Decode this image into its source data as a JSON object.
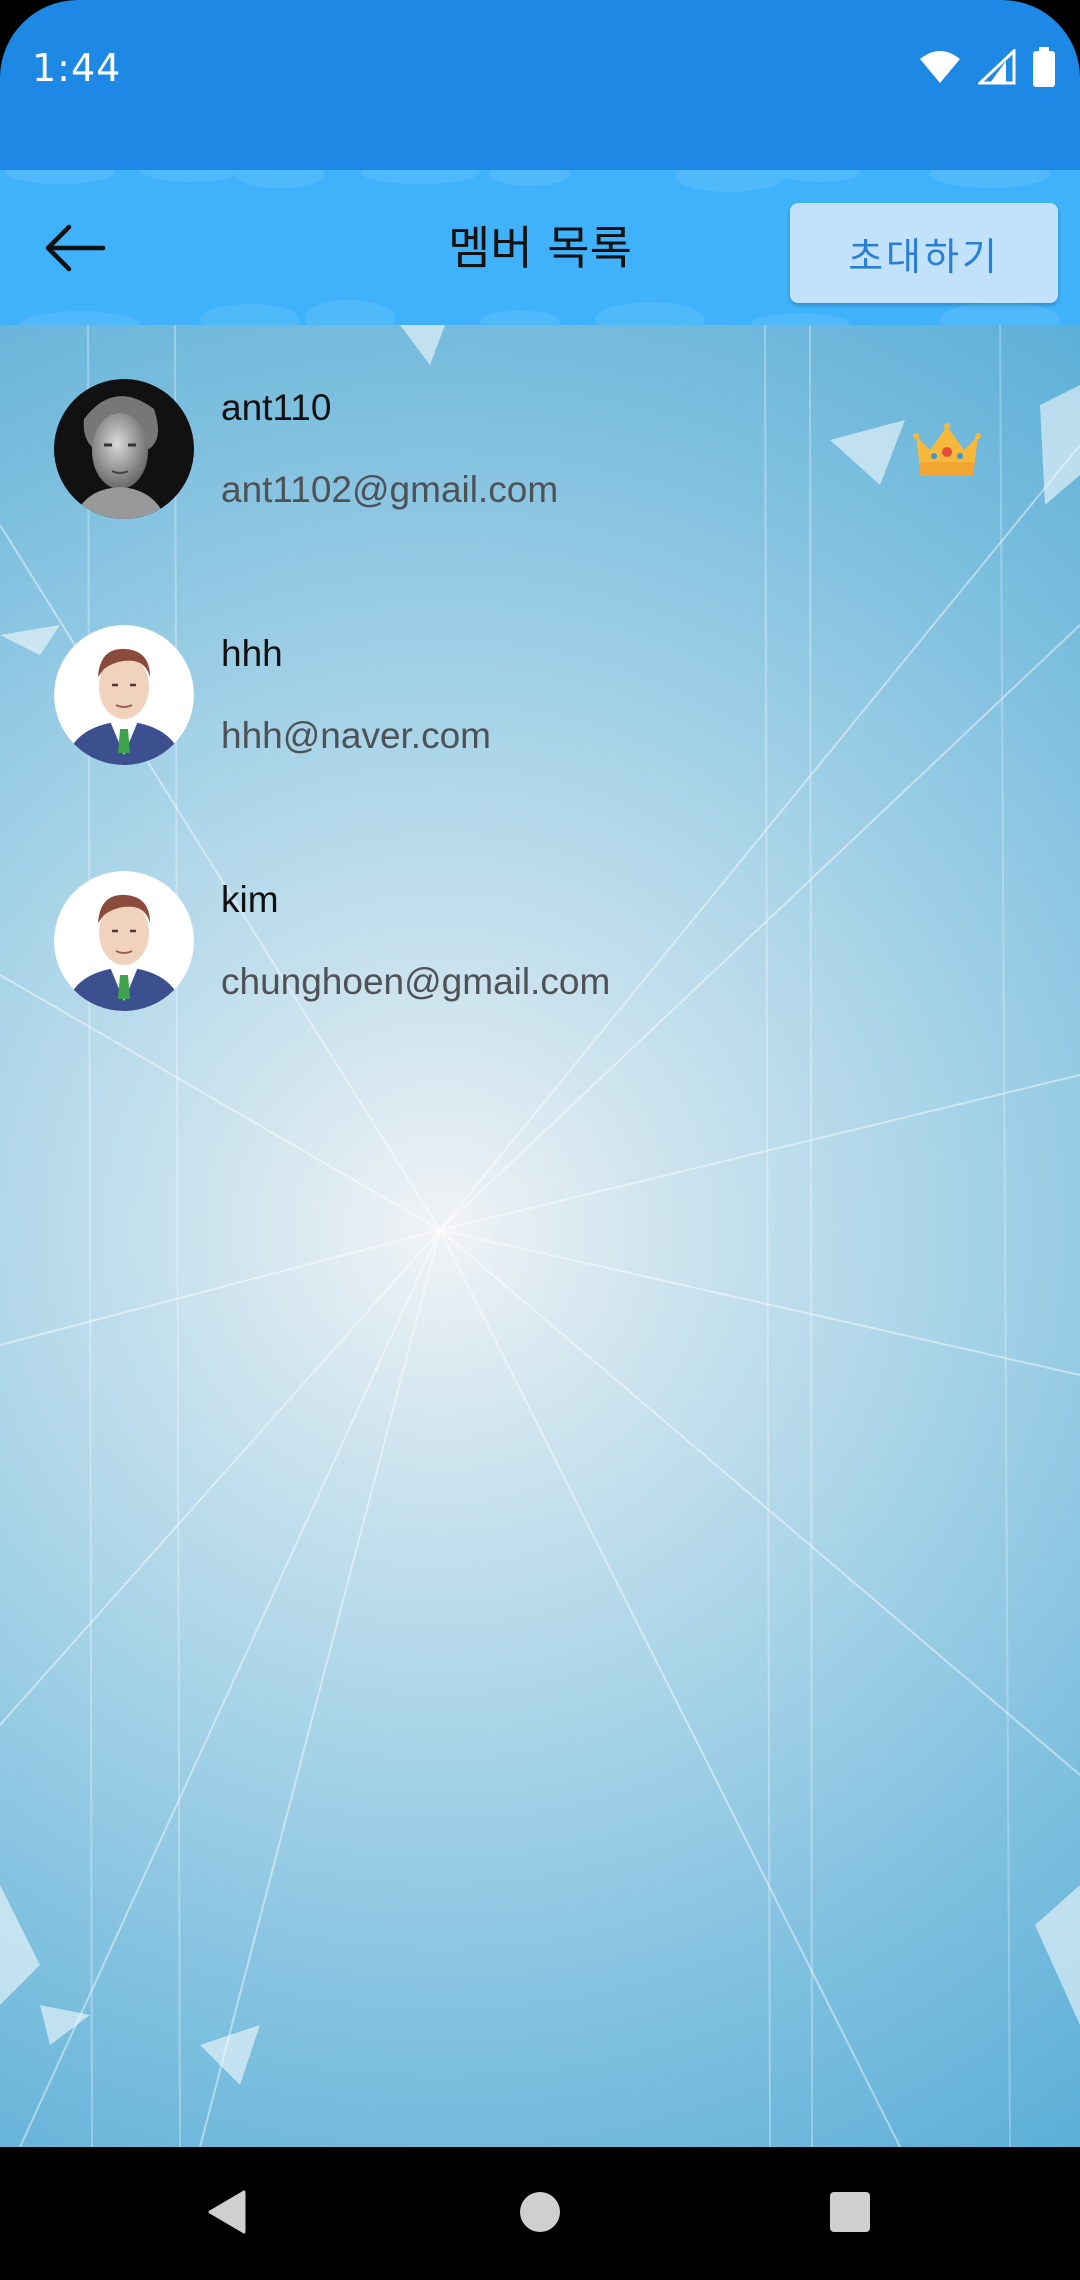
{
  "status_bar": {
    "time": "1:44",
    "icons": [
      "wifi-icon",
      "cellular-signal-icon",
      "battery-icon"
    ]
  },
  "app_bar": {
    "back_icon": "arrow-left-icon",
    "title": "멤버 목록",
    "invite_label": "초대하기"
  },
  "members": [
    {
      "name": "ant110",
      "email": "ant1102@gmail.com",
      "avatar": "portrait-photo",
      "is_owner": true,
      "badge_icon": "crown-icon"
    },
    {
      "name": "hhh",
      "email": "hhh@naver.com",
      "avatar": "default-businessman-avatar",
      "is_owner": false
    },
    {
      "name": "kim",
      "email": "chunghoen@gmail.com",
      "avatar": "default-businessman-avatar",
      "is_owner": false
    }
  ],
  "nav_bar": {
    "icons": [
      "back-triangle-icon",
      "home-circle-icon",
      "recents-square-icon"
    ]
  },
  "colors": {
    "status_bar": "#1e88e5",
    "app_bar": "#3fb2fb",
    "invite_button_bg": "#c2e2fb",
    "invite_button_text": "#2a7fd4",
    "crown_gold": "#f6b93b"
  }
}
